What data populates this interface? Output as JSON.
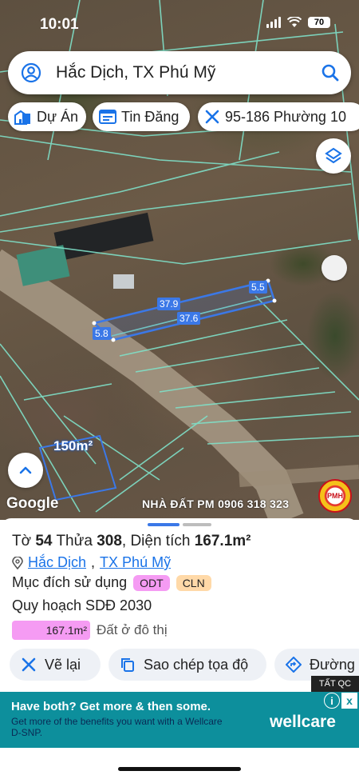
{
  "status": {
    "time": "10:01",
    "battery": "70"
  },
  "search": {
    "query": "Hắc Dịch, TX Phú Mỹ"
  },
  "chips": [
    {
      "label": "Dự Án",
      "icon": "building-icon"
    },
    {
      "label": "Tin Đăng",
      "icon": "listing-icon"
    },
    {
      "label": "95-186 Phường 10",
      "icon": "tools-icon"
    }
  ],
  "map": {
    "dimensions": [
      "37.9",
      "37.6",
      "5.5",
      "5.8"
    ],
    "area_label": "150m²",
    "attribution": "Google",
    "watermark": "NHÀ ĐẤT PM 0906 318 323",
    "logo_text": "PMH"
  },
  "plot": {
    "sheet_label": "Tờ",
    "sheet_number": "54",
    "parcel_label": "Thửa",
    "parcel_number": "308",
    "area_label": "Diện tích",
    "area_value": "167.1m²",
    "locality": "Hắc Dịch",
    "town": "TX Phú Mỹ",
    "purpose_label": "Mục đích sử dụng",
    "tags": [
      "ODT",
      "CLN"
    ],
    "plan_label": "Quy hoạch SDĐ 2030",
    "plan_area": "167.1m²",
    "plan_desc": "Đất ở đô thị"
  },
  "actions": [
    "Vẽ lại",
    "Sao chép tọa độ",
    "Đường"
  ],
  "ad": {
    "tag": "TẤT QC",
    "headline_a": "Have both? Get more",
    "headline_b": "& then some.",
    "subline": "Get more of the benefits you want with a Wellcare D-SNP.",
    "brand": "wellcare",
    "info": "i",
    "close": "x"
  },
  "colors": {
    "accent": "#1a73e8",
    "parcel_lines": "#7fe0c8",
    "selected_parcel": "#3b78e7",
    "odt_tag": "#f59bf3",
    "cln_tag": "#ffd9a8",
    "ad_bg": "#0d8f9c"
  }
}
